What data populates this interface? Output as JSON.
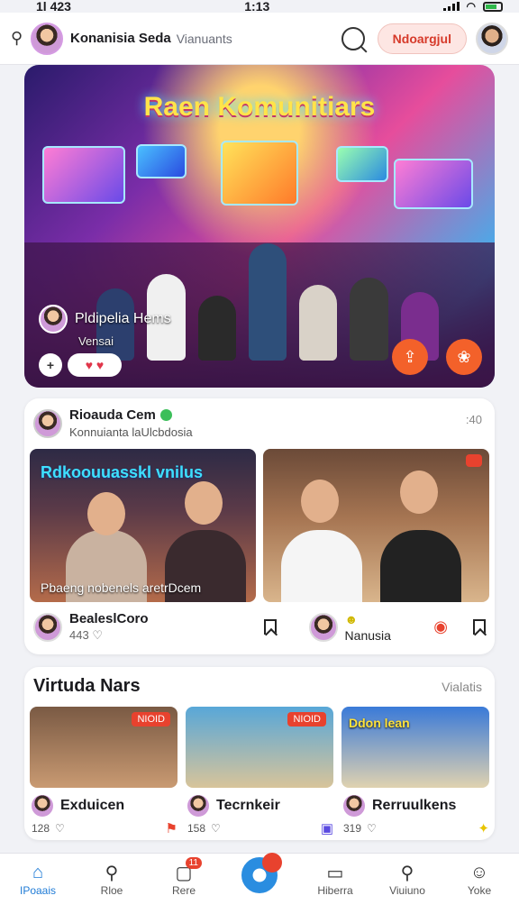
{
  "status": {
    "time_left": "1l 423",
    "time_center": "1:13"
  },
  "header": {
    "profile_name": "Konanisia Seda",
    "profile_sub": "Vianuants",
    "cta_label": "Ndoargjul"
  },
  "hero": {
    "title": "Raen Komunitiars",
    "host_name": "Pldipelia Hems",
    "host_sub": "Vensai"
  },
  "feed": {
    "author": "Rioauda Cem",
    "author_sub": "Konnuianta laUlcbdosia",
    "time": ":40",
    "photo1_overlay": "Rdkoouuasskl vnilus",
    "photo1_caption": "Pbaeng nobenels aretrDcem",
    "photo2_tag": "",
    "footer_user1": "BealeslCoro",
    "footer_count1": "443",
    "footer_user2": "Nanusia"
  },
  "virtual": {
    "heading": "Virtuda Nars",
    "more": "Vialatis",
    "tiles": [
      {
        "name": "Exduicen",
        "count": "128",
        "tag": "NIOID"
      },
      {
        "name": "Tecrnkeir",
        "count": "158",
        "tag": "NIOID"
      },
      {
        "name": "Rerruulkens",
        "count": "319",
        "tag": ""
      }
    ],
    "tile3_label": "Ddon lean"
  },
  "nav": {
    "items": [
      {
        "label": "IPoaais",
        "icon": "home-icon"
      },
      {
        "label": "Rloe",
        "icon": "search-icon"
      },
      {
        "label": "Rere",
        "icon": "bell-icon",
        "badge": "11"
      },
      {
        "label": "Hiberra",
        "icon": "chat-icon"
      },
      {
        "label": "Viuiuno",
        "icon": "explore-icon"
      },
      {
        "label": "Yoke",
        "icon": "profile-icon"
      }
    ]
  },
  "colors": {
    "accent": "#1f7bd6",
    "cta_text": "#d63a2a",
    "fab": "#f3612a",
    "badge": "#e8422e"
  }
}
